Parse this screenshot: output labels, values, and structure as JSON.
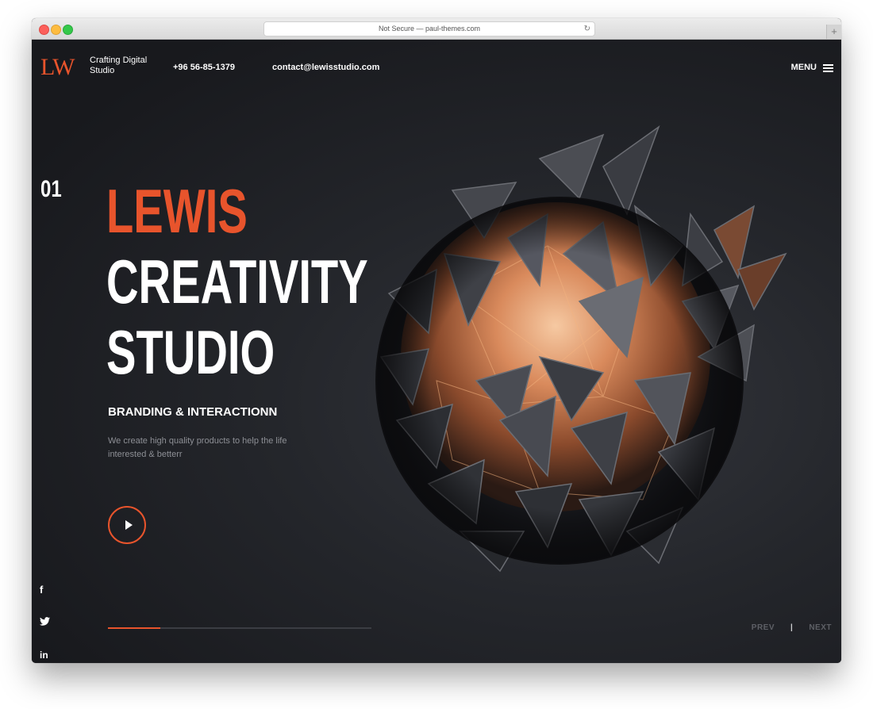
{
  "browser": {
    "url_text": "Not Secure — paul-themes.com"
  },
  "header": {
    "logo": "LW",
    "tagline": "Crafting Digital Studio",
    "phone": "+96 56-85-1379",
    "email": "contact@lewisstudio.com",
    "menu_label": "MENU"
  },
  "hero": {
    "slide_number": "01",
    "title_line1": "LEWIS",
    "title_line2": "CREATIVITY",
    "title_line3": "STUDIO",
    "subtitle": "BRANDING & INTERACTIONN",
    "description": "We create high quality products to help the life interested & betterr",
    "progress_fraction": 0.2
  },
  "social": [
    "facebook-icon",
    "twitter-icon",
    "linkedin-icon"
  ],
  "pager": {
    "prev": "PREV",
    "separator": "|",
    "next": "NEXT"
  },
  "colors": {
    "accent": "#e8542c",
    "background": "#1d1f23",
    "copper": "#c7794f"
  }
}
